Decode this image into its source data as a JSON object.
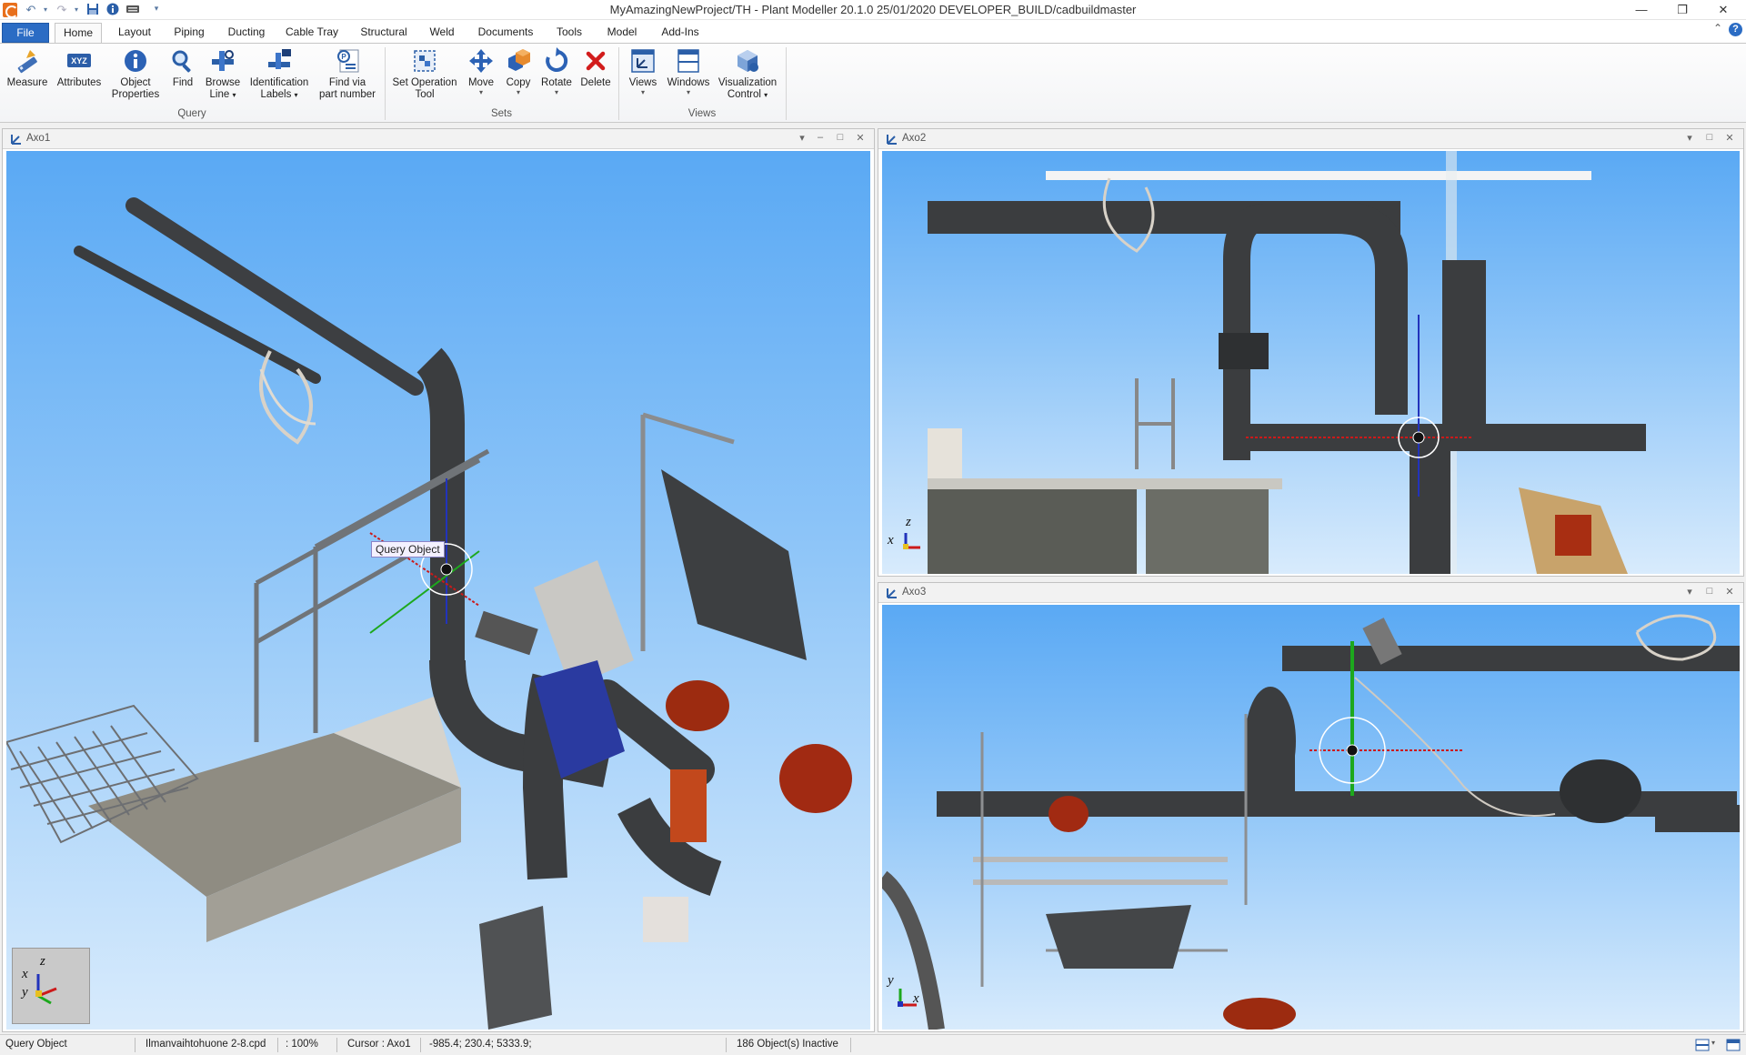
{
  "titlebar": {
    "title": "MyAmazingNewProject/TH - Plant Modeller 20.1.0 25/01/2020 DEVELOPER_BUILD/cadbuildmaster",
    "minimize": "—",
    "restore": "❐",
    "close": "✕"
  },
  "quick_access": [
    "undo-icon",
    "redo-icon",
    "save-icon",
    "info-icon",
    "keyboard-icon",
    "customize-icon"
  ],
  "tabs": {
    "file": "File",
    "home": "Home",
    "layout": "Layout",
    "piping": "Piping",
    "ducting": "Ducting",
    "cable_tray": "Cable Tray",
    "structural": "Structural",
    "weld": "Weld",
    "documents": "Documents",
    "tools": "Tools",
    "model": "Model",
    "add_ins": "Add-Ins"
  },
  "ribbon": {
    "measure": "Measure",
    "attributes": "Attributes",
    "object_properties_1": "Object",
    "object_properties_2": "Properties",
    "find": "Find",
    "browse_line_1": "Browse",
    "browse_line_2": "Line",
    "identification_labels_1": "Identification",
    "identification_labels_2": "Labels",
    "find_part_1": "Find via",
    "find_part_2": "part number",
    "set_operation_1": "Set Operation",
    "set_operation_2": "Tool",
    "move": "Move",
    "copy": "Copy",
    "rotate": "Rotate",
    "delete": "Delete",
    "views": "Views",
    "windows": "Windows",
    "visualization_1": "Visualization",
    "visualization_2": "Control",
    "group_query": "Query",
    "group_sets": "Sets",
    "group_views": "Views",
    "xyz_badge": "XYZ"
  },
  "viewports": {
    "axo1": {
      "title": "Axo1",
      "tooltip": "Query Object"
    },
    "axo2": {
      "title": "Axo2"
    },
    "axo3": {
      "title": "Axo3"
    }
  },
  "gizmo": {
    "x": "x",
    "y": "y",
    "z": "z"
  },
  "colors": {
    "sky_top": "#5aa9f4",
    "sky_bottom": "#d8ebfc",
    "pipe": "#3b3d3f",
    "accent_blue": "#2b6cc4"
  },
  "statusbar": {
    "mode": "Query Object",
    "file": "Ilmanvaihtohuone 2-8.cpd",
    "zoom": ": 100%",
    "cursor": "Cursor : Axo1",
    "coords": "-985.4; 230.4; 5333.9;",
    "objects": "186 Object(s) Inactive"
  }
}
